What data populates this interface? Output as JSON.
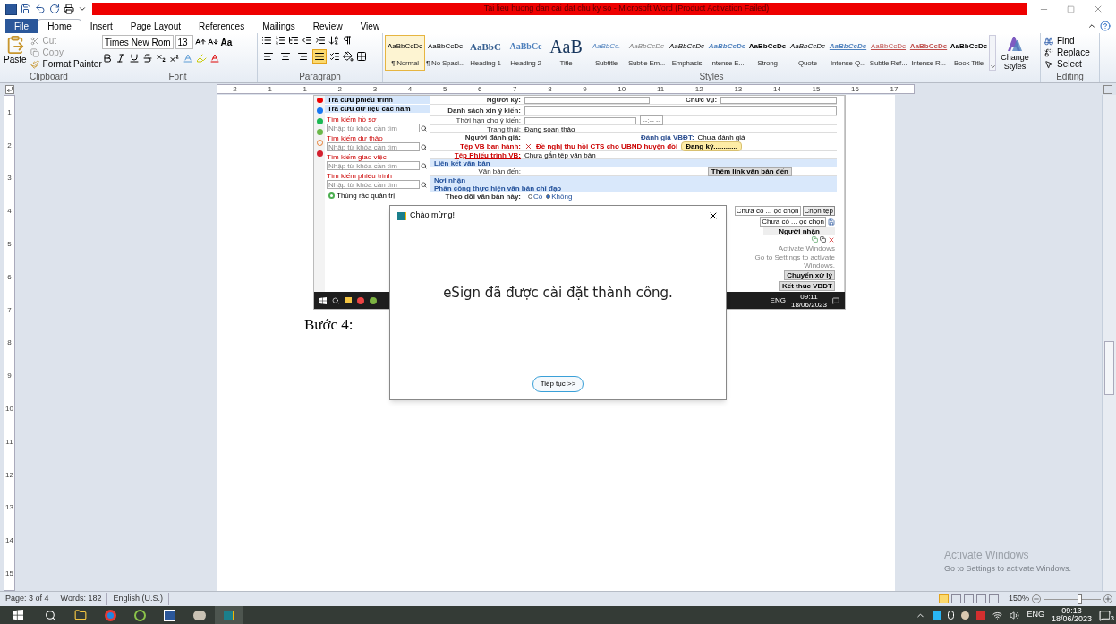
{
  "window": {
    "title": "Tai lieu huong dan cai dat chu ky so  -  Microsoft Word (Product Activation Failed)"
  },
  "tabs": [
    {
      "label": "File",
      "kind": "file",
      "selected": false
    },
    {
      "label": "Home",
      "kind": "tab",
      "selected": true
    },
    {
      "label": "Insert",
      "kind": "tab",
      "selected": false
    },
    {
      "label": "Page Layout",
      "kind": "tab",
      "selected": false
    },
    {
      "label": "References",
      "kind": "tab",
      "selected": false
    },
    {
      "label": "Mailings",
      "kind": "tab",
      "selected": false
    },
    {
      "label": "Review",
      "kind": "tab",
      "selected": false
    },
    {
      "label": "View",
      "kind": "tab",
      "selected": false
    }
  ],
  "clipboard": {
    "group": "Clipboard",
    "paste": "Paste",
    "cut": "Cut",
    "copy": "Copy",
    "format_painter": "Format Painter"
  },
  "font": {
    "group": "Font",
    "name": "Times New Rom",
    "size": "13",
    "change_case": "Aa"
  },
  "paragraph": {
    "group": "Paragraph",
    "align": [
      {
        "selected": false
      },
      {
        "selected": false
      },
      {
        "selected": false
      },
      {
        "selected": true
      }
    ]
  },
  "styles": {
    "group": "Styles",
    "change_styles": "Change Styles",
    "items": [
      {
        "preview": "AaBbCcDc",
        "label": "¶ Normal",
        "selected": true
      },
      {
        "preview": "AaBbCcDc",
        "label": "¶ No Spaci...",
        "selected": false
      },
      {
        "preview": "AaBbC",
        "label": "Heading 1",
        "selected": false
      },
      {
        "preview": "AaBbCc",
        "label": "Heading 2",
        "selected": false
      },
      {
        "preview": "AaB",
        "label": "Title",
        "selected": false
      },
      {
        "preview": "AaBbCc.",
        "label": "Subtitle",
        "selected": false
      },
      {
        "preview": "AaBbCcDc",
        "label": "Subtle Em...",
        "selected": false
      },
      {
        "preview": "AaBbCcDc",
        "label": "Emphasis",
        "selected": false
      },
      {
        "preview": "AaBbCcDc",
        "label": "Intense E...",
        "selected": false
      },
      {
        "preview": "AaBbCcDc",
        "label": "Strong",
        "selected": false
      },
      {
        "preview": "AaBbCcDc",
        "label": "Quote",
        "selected": false
      },
      {
        "preview": "AaBbCcDc",
        "label": "Intense Q...",
        "selected": false
      },
      {
        "preview": "AaBbCcDc",
        "label": "Subtle Ref...",
        "selected": false
      },
      {
        "preview": "AaBbCcDc",
        "label": "Intense R...",
        "selected": false
      },
      {
        "preview": "AaBbCcDc",
        "label": "Book Title",
        "selected": false
      }
    ]
  },
  "editing": {
    "group": "Editing",
    "find": "Find",
    "replace": "Replace",
    "select": "Select"
  },
  "ruler": {
    "marks": [
      "2",
      "1",
      "1",
      "2",
      "3",
      "4",
      "5",
      "6",
      "7",
      "8",
      "9",
      "10",
      "11",
      "12",
      "13",
      "14",
      "15",
      "16",
      "17"
    ],
    "vertical_marks": [
      "1",
      "2",
      "3",
      "4",
      "5",
      "6",
      "7",
      "8",
      "9",
      "10",
      "11",
      "12",
      "13",
      "14",
      "15"
    ]
  },
  "embedded_screenshot": {
    "nav": [
      "Tra cứu phiếu trình",
      "Tra cứu dữ liệu các năm"
    ],
    "searches": [
      {
        "label": "Tìm kiếm hồ sơ",
        "placeholder": "Nhập từ khóa cần tìm"
      },
      {
        "label": "Tìm kiếm dự thảo",
        "placeholder": "Nhập từ khóa cần tìm"
      },
      {
        "label": "Tìm kiếm giao việc",
        "placeholder": "Nhập từ khóa cần tìm"
      },
      {
        "label": "Tìm kiếm phiếu trình",
        "placeholder": "Nhập từ khóa cần tìm"
      }
    ],
    "trash": "Thùng rác quản trị",
    "more": "...",
    "rows": [
      {
        "kind": "select2",
        "label": "Người ký:",
        "label2": "Chức vụ:"
      },
      {
        "kind": "textarea",
        "label": "Danh sách xin ý kiến:"
      },
      {
        "kind": "date",
        "label": "Thời hạn cho ý kiến:",
        "time": "--:-- --"
      },
      {
        "kind": "text",
        "label": "Trạng thái:",
        "value": "Đang soạn thảo"
      },
      {
        "kind": "pair",
        "label": "Người đánh giá:",
        "label2": "Đánh giá VBĐT:",
        "value2": "Chưa đánh giá"
      },
      {
        "kind": "file",
        "label": "Tệp VB ban hành:",
        "value": "Đề nghị thu hồi CTS cho UBND huyện đồi",
        "button": "Đang ký............"
      },
      {
        "kind": "filelink",
        "label": "Tệp Phiếu trình VB:",
        "value": "Chưa gắn tệp văn bản"
      },
      {
        "kind": "section",
        "label": "Liên kết văn bản"
      },
      {
        "kind": "link",
        "label": "Văn bản đến:",
        "button": "Thêm link văn bản đến"
      },
      {
        "kind": "section",
        "label": "Nơi nhận"
      },
      {
        "kind": "section",
        "label": "Phân công thực hiện văn bản chỉ đạo"
      },
      {
        "kind": "radio",
        "label": "Theo dõi văn bản này:",
        "options": [
          {
            "label": "Có",
            "selected": false
          },
          {
            "label": "Không",
            "selected": true
          }
        ]
      }
    ],
    "file_pick": {
      "field1": "Chưa có ... ọc chọn",
      "button": "Chọn tệp",
      "field2": "Chưa có ... ọc chọn"
    },
    "recipients_header": "Người nhận",
    "activate": {
      "title": "Activate Windows",
      "hint": "Go to Settings to activate Windows."
    },
    "buttons": [
      "Chuyển xử lý",
      "Kết thúc VBĐT"
    ],
    "taskbar": {
      "lang": "ENG",
      "time": "09:11",
      "date": "18/06/2023"
    }
  },
  "document": {
    "step": "Bước 4:"
  },
  "dialog": {
    "title": "Chào mừng!",
    "message": "eSign đã được cài đặt thành công.",
    "button": "Tiếp tục >>"
  },
  "status_bar": {
    "page": "Page: 3 of 4",
    "words": "Words: 182",
    "language": "English (U.S.)",
    "zoom": "150%",
    "zoom_slider": {
      "level": 0.62
    },
    "views": [
      {
        "selected": true
      },
      {
        "selected": false
      },
      {
        "selected": false
      },
      {
        "selected": false
      },
      {
        "selected": false
      }
    ]
  },
  "activate_windows": {
    "title": "Activate Windows",
    "hint": "Go to Settings to activate Windows."
  },
  "taskbar": {
    "lang": "ENG",
    "time": "09:13",
    "date": "18/06/2023",
    "notifications": "3"
  }
}
